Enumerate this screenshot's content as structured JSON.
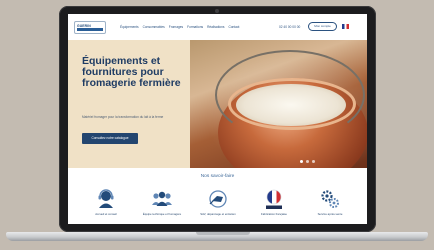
{
  "nav": {
    "logo_text": "GUERIN",
    "menu": [
      "Équipements",
      "Consommables",
      "Fromages",
      "Formations",
      "Réalisations",
      "Contact"
    ],
    "phone": "02 40 00 00 00",
    "account_label": "Mon compte",
    "language": "FR"
  },
  "hero": {
    "title": "Équipements et fournitures pour fromagerie fermière",
    "description": "Matériel fromager pour la transformation du lait à la ferme",
    "button_label": "Consultez notre catalogue",
    "slide_count": 3,
    "active_slide": 1
  },
  "section": {
    "title": "Nos savoir-faire"
  },
  "features": [
    {
      "icon": "headset-icon",
      "label": "Accueil et conseil"
    },
    {
      "icon": "team-icon",
      "label": "Équipe technique et fromagère"
    },
    {
      "icon": "delivery-icon",
      "label": "SAV, dépannage et entretien"
    },
    {
      "icon": "france-flag-icon",
      "label": "Fabrication française"
    },
    {
      "icon": "gears-icon",
      "label": "Service après-vente"
    }
  ],
  "colors": {
    "background": "#c3bbb1",
    "brand_blue": "#23456f",
    "hero_bg": "#f0e1c6",
    "accent": "#3f6a9a"
  }
}
